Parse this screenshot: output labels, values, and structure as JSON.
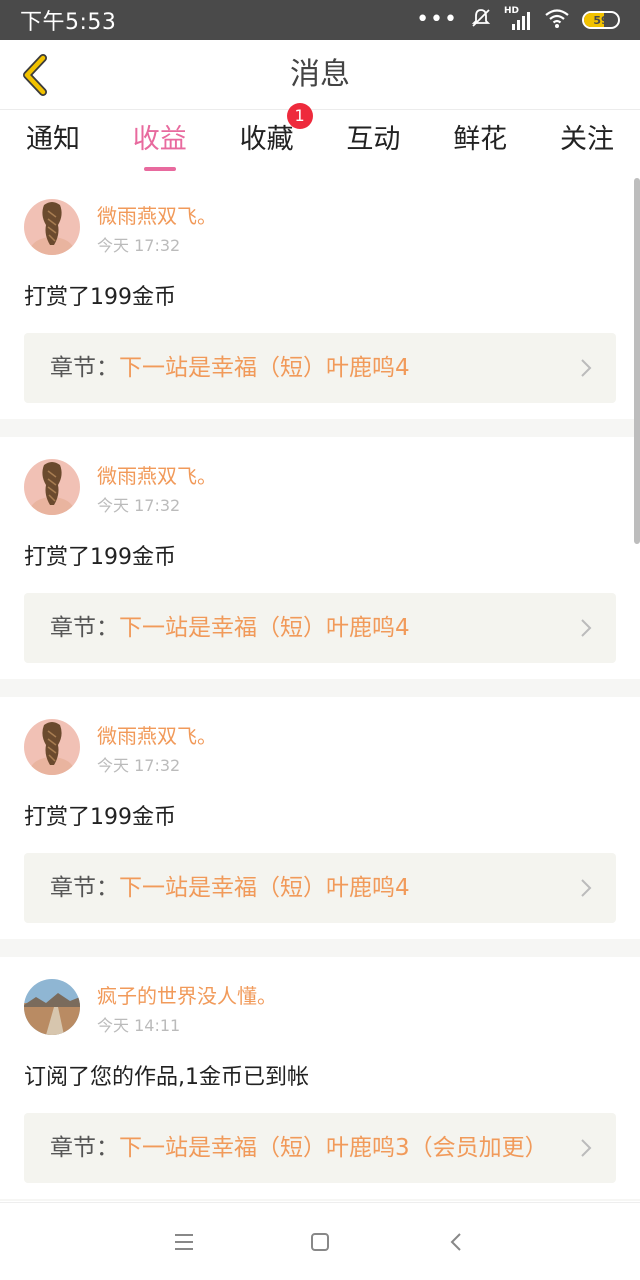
{
  "status_bar": {
    "time": "下午5:53",
    "network": "HD",
    "battery_level": "59",
    "battery_fill": 0.59,
    "icons": [
      "more-dots-icon",
      "silent-icon",
      "signal-icon",
      "wifi-icon",
      "battery-icon"
    ]
  },
  "header": {
    "title": "消息",
    "back_icon": "chevron-left-icon",
    "accent_color": "#f2c200"
  },
  "tabs": [
    {
      "label": "通知",
      "active": false
    },
    {
      "label": "收益",
      "active": true
    },
    {
      "label": "收藏",
      "active": false,
      "badge": "1"
    },
    {
      "label": "互动",
      "active": false
    },
    {
      "label": "鲜花",
      "active": false
    },
    {
      "label": "关注",
      "active": false
    }
  ],
  "colors": {
    "tab_active": "#e86a9e",
    "username": "#f19a5a",
    "badge": "#ee2a3c"
  },
  "messages": [
    {
      "username": "微雨燕双飞。",
      "time": "今天 17:32",
      "action": "打赏了199金币",
      "chapter_label": "章节：",
      "chapter_title": "下一站是幸福（短）叶鹿鸣4"
    },
    {
      "username": "微雨燕双飞。",
      "time": "今天 17:32",
      "action": "打赏了199金币",
      "chapter_label": "章节：",
      "chapter_title": "下一站是幸福（短）叶鹿鸣4"
    },
    {
      "username": "微雨燕双飞。",
      "time": "今天 17:32",
      "action": "打赏了199金币",
      "chapter_label": "章节：",
      "chapter_title": "下一站是幸福（短）叶鹿鸣4"
    },
    {
      "username": "疯子的世界没人懂。",
      "time": "今天 14:11",
      "action": "订阅了您的作品,1金币已到帐",
      "chapter_label": "章节：",
      "chapter_title": "下一站是幸福（短）叶鹿鸣3（会员加更）"
    }
  ],
  "nav_bar": {
    "icons": [
      "menu-icon",
      "home-icon",
      "back-icon"
    ]
  }
}
